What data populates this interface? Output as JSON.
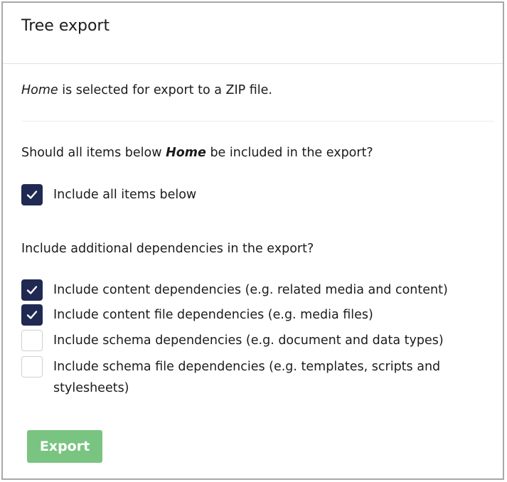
{
  "dialog": {
    "title": "Tree export"
  },
  "intro": {
    "item_name": "Home",
    "text": " is selected for export to a ZIP file."
  },
  "descendants": {
    "question_prefix": "Should all items below ",
    "question_item": "Home",
    "question_suffix": " be included in the export?",
    "checkbox": {
      "label": "Include all items below",
      "checked": true
    }
  },
  "dependencies": {
    "question": "Include additional dependencies in the export?",
    "options": [
      {
        "label": "Include content dependencies (e.g. related media and content)",
        "checked": true
      },
      {
        "label": "Include content file dependencies (e.g. media files)",
        "checked": true
      },
      {
        "label": "Include schema dependencies (e.g. document and data types)",
        "checked": false
      },
      {
        "label": "Include schema file dependencies (e.g. templates, scripts and stylesheets)",
        "checked": false
      }
    ]
  },
  "actions": {
    "export_label": "Export"
  },
  "icons": {
    "checkbox_checked": "checkmark-icon"
  },
  "colors": {
    "checkbox_checked_bg": "#1f2952",
    "export_button_bg": "#79c480",
    "border": "#a8a8a8"
  }
}
